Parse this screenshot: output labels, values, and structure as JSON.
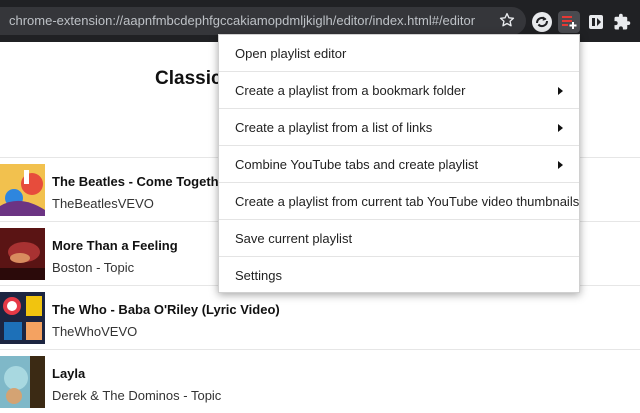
{
  "browser": {
    "url": "chrome-extension://aapnfmbcdephfgccakiamopdmljkiglh/editor/index.html#/editor",
    "icons": [
      "star-icon",
      "sync-icon",
      "playlist-add-icon",
      "media-icon",
      "puzzle-icon"
    ]
  },
  "page": {
    "title": "Classic",
    "songs": [
      {
        "title": "The Beatles - Come Togeth",
        "artist": "TheBeatlesVEVO"
      },
      {
        "title": "More Than a Feeling",
        "artist": "Boston - Topic"
      },
      {
        "title": "The Who - Baba O'Riley (Lyric Video)",
        "artist": "TheWhoVEVO"
      },
      {
        "title": "Layla",
        "artist": "Derek & The Dominos - Topic"
      }
    ]
  },
  "menu": {
    "items": [
      {
        "label": "Open playlist editor",
        "has_submenu": false
      },
      {
        "label": "Create a playlist from a bookmark folder",
        "has_submenu": true
      },
      {
        "label": "Create a playlist from a list of links",
        "has_submenu": true
      },
      {
        "label": "Combine YouTube tabs and create playlist",
        "has_submenu": true
      },
      {
        "label": "Create a playlist from current tab YouTube video thumbnails",
        "has_submenu": false
      },
      {
        "label": "Save current playlist",
        "has_submenu": false
      },
      {
        "label": "Settings",
        "has_submenu": false
      }
    ]
  },
  "colors": {
    "browser_bg": "#202124",
    "omnibox_bg": "#35363a",
    "active_extension": "#e53935"
  }
}
